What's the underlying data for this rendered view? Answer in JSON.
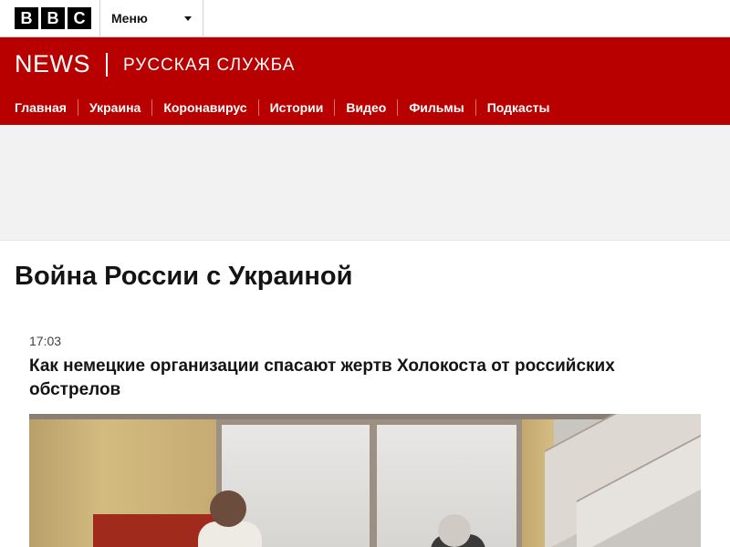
{
  "topbar": {
    "logo_letters": [
      "B",
      "B",
      "C"
    ],
    "menu_label": "Меню"
  },
  "brand": {
    "news": "NEWS",
    "service": "РУССКАЯ СЛУЖБА",
    "color": "#b80000"
  },
  "nav": {
    "items": [
      {
        "label": "Главная"
      },
      {
        "label": "Украина"
      },
      {
        "label": "Коронавирус"
      },
      {
        "label": "Истории"
      },
      {
        "label": "Видео"
      },
      {
        "label": "Фильмы"
      },
      {
        "label": "Подкасты"
      }
    ]
  },
  "page": {
    "title": "Война России с Украиной"
  },
  "article": {
    "time": "17:03",
    "headline": "Как немецкие организации спасают жертв Холокоста от российских обстрелов"
  }
}
